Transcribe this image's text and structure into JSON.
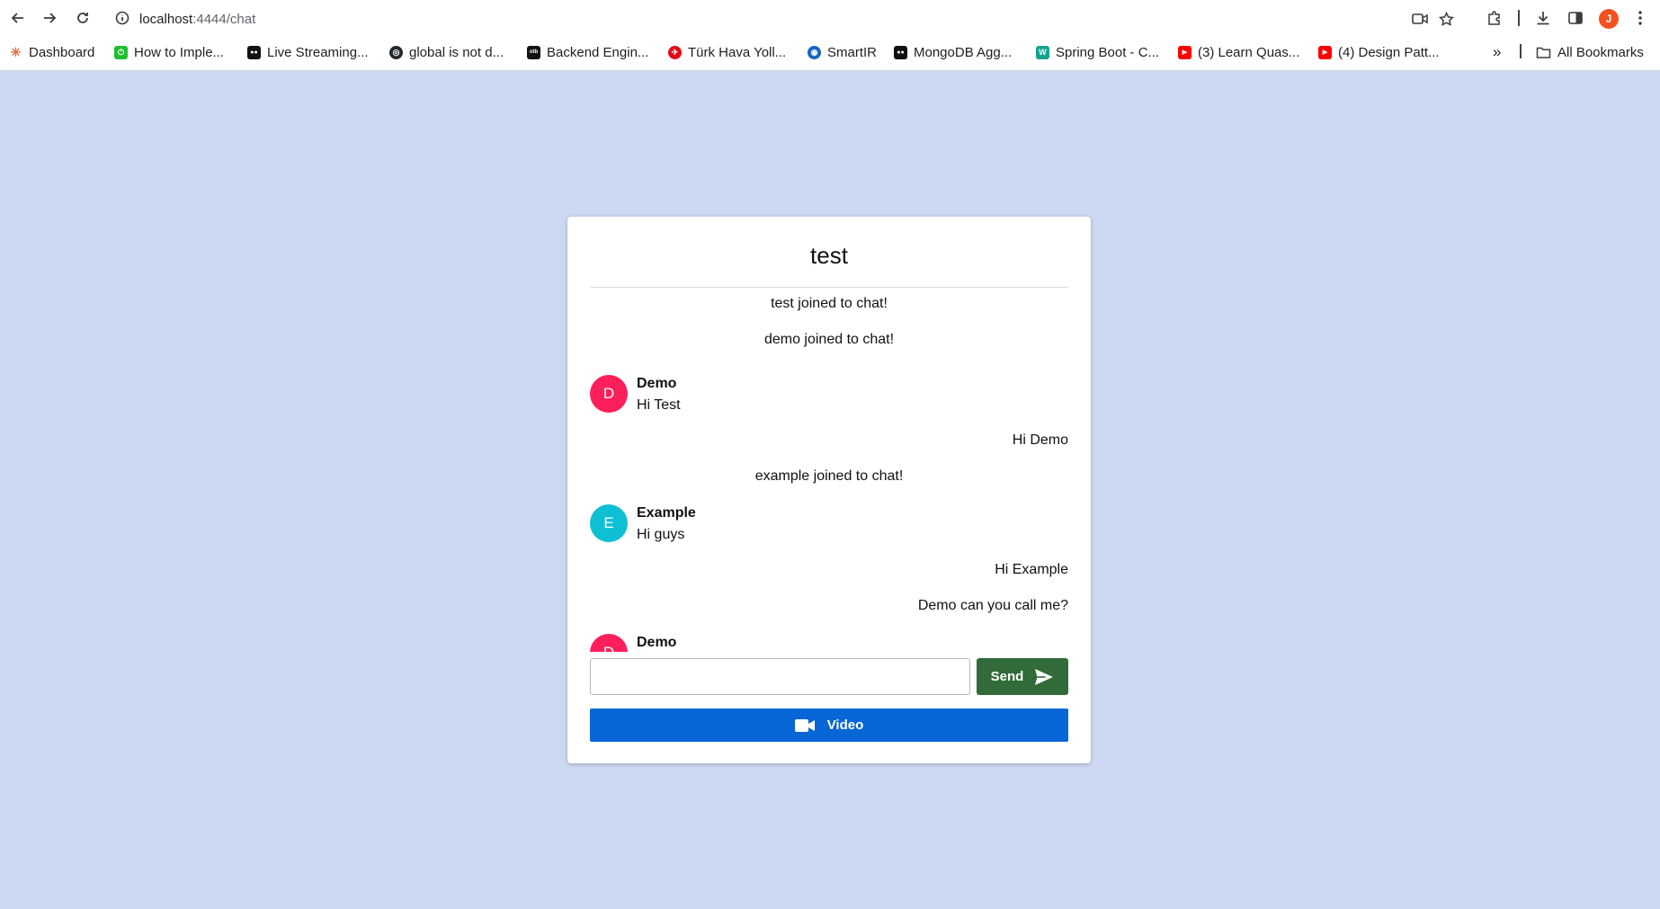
{
  "browser": {
    "url_host": "localhost",
    "url_rest": ":4444/chat",
    "profile_initial": "J",
    "bookmarks": [
      {
        "label": "Dashboard",
        "color": "#e8eaed",
        "glyph": "✳"
      },
      {
        "label": "How to Imple...",
        "color": "#1fbf2e",
        "glyph": "⏻"
      },
      {
        "label": "Live Streaming...",
        "color": "#111111",
        "glyph": "●●"
      },
      {
        "label": "global is not d...",
        "color": "#24292f",
        "glyph": "◎"
      },
      {
        "label": "Backend Engin...",
        "color": "#111111",
        "glyph": "otb"
      },
      {
        "label": "Türk Hava Yoll...",
        "color": "#e30a17",
        "glyph": "✈"
      },
      {
        "label": "SmartIR",
        "color": "#1565c0",
        "glyph": "◉"
      },
      {
        "label": "MongoDB Agg...",
        "color": "#111111",
        "glyph": "●●"
      },
      {
        "label": "Spring Boot - C...",
        "color": "#13a38d",
        "glyph": "W"
      },
      {
        "label": "(3) Learn Quas...",
        "color": "#ff0000",
        "glyph": "▶"
      },
      {
        "label": "(4) Design Patt...",
        "color": "#ff0000",
        "glyph": "▶"
      }
    ],
    "overflow_label": "»",
    "all_bookmarks": "All Bookmarks"
  },
  "chat": {
    "title": "test",
    "messages": [
      {
        "kind": "system",
        "text": "test joined to chat!"
      },
      {
        "kind": "system",
        "text": "demo joined to chat!"
      },
      {
        "kind": "other",
        "initial": "D",
        "name": "Demo",
        "text": "Hi Test",
        "avatar_color": "#ff1f5a"
      },
      {
        "kind": "mine",
        "text": "Hi Demo"
      },
      {
        "kind": "system",
        "text": "example joined to chat!"
      },
      {
        "kind": "other",
        "initial": "E",
        "name": "Example",
        "text": "Hi guys",
        "avatar_color": "#0fbfd4"
      },
      {
        "kind": "mine",
        "text": "Hi Example"
      },
      {
        "kind": "mine",
        "text": "Demo can you call me?"
      },
      {
        "kind": "other",
        "initial": "D",
        "name": "Demo",
        "text": "",
        "avatar_color": "#ff1f5a"
      }
    ],
    "input_value": "",
    "send_label": "Send",
    "video_label": "Video",
    "send_color": "#316b3a",
    "video_color": "#0766d6"
  }
}
